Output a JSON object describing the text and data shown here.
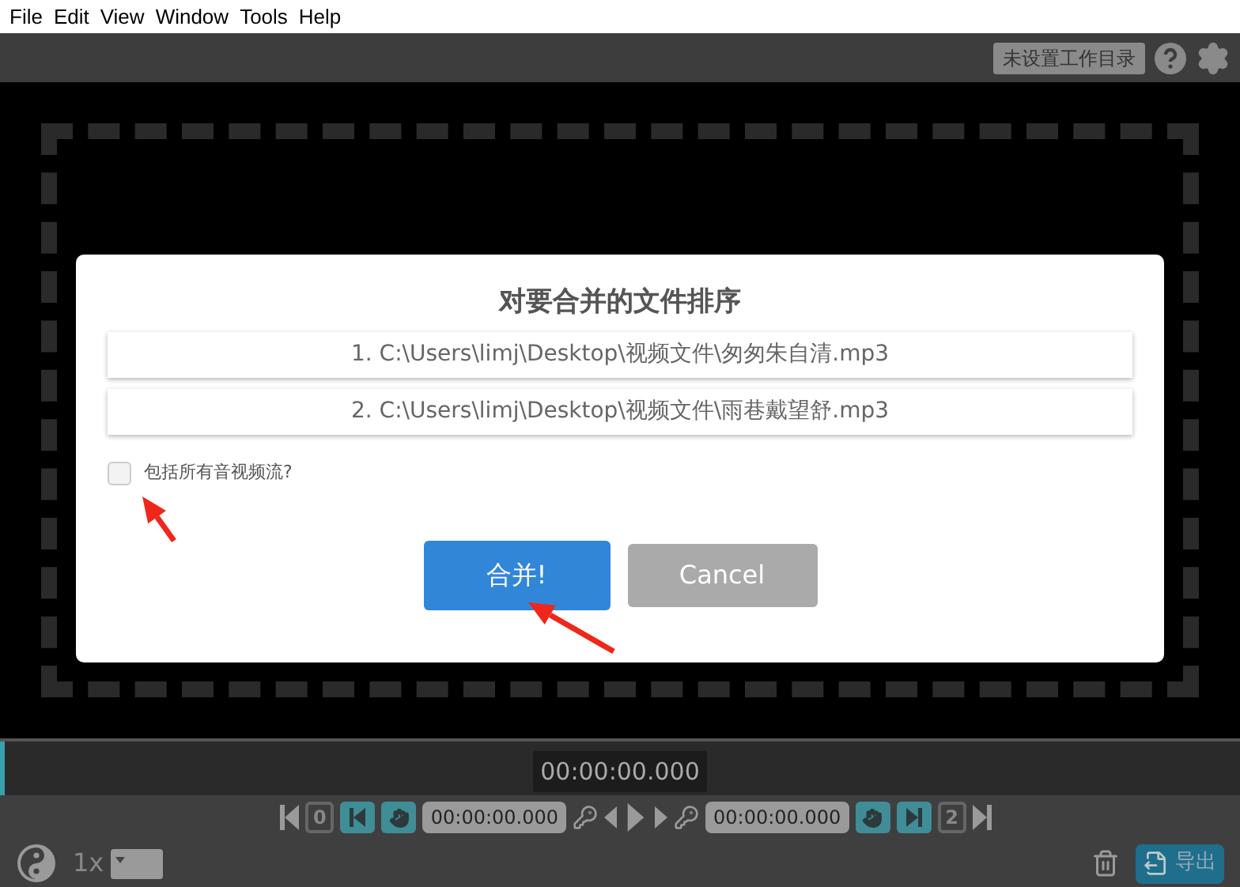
{
  "menu": [
    "File",
    "Edit",
    "View",
    "Window",
    "Tools",
    "Help"
  ],
  "toolbar": {
    "workdir_button": "未设置工作目录"
  },
  "dialog": {
    "title": "对要合并的文件排序",
    "files": [
      "1. C:\\Users\\limj\\Desktop\\视频文件\\匆匆朱自清.mp3",
      "2. C:\\Users\\limj\\Desktop\\视频文件\\雨巷戴望舒.mp3"
    ],
    "include_all_streams": {
      "label": "包括所有音视频流?",
      "checked": false
    },
    "merge_button": "合并!",
    "cancel_button": "Cancel"
  },
  "timeline": {
    "time": "00:00:00.000"
  },
  "controls": {
    "start_marker": "0",
    "start_time": "00:00:00.000",
    "end_time": "00:00:00.000",
    "end_marker": "2"
  },
  "speed": "1x",
  "export_button": "导出"
}
